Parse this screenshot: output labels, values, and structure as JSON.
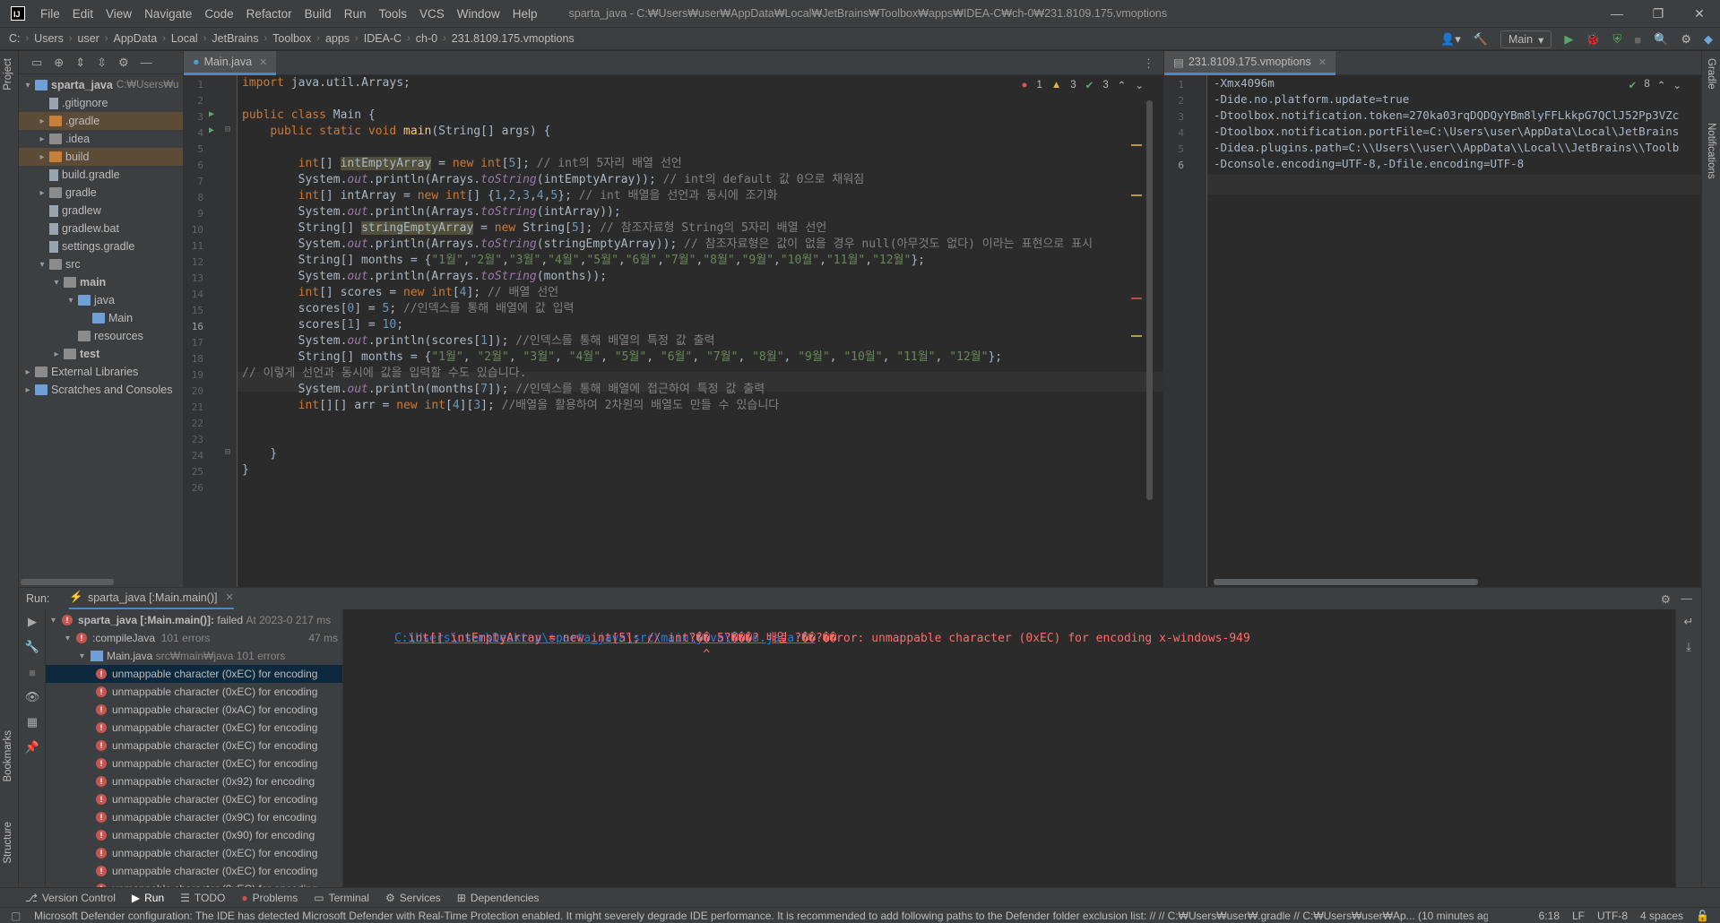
{
  "window": {
    "title": "sparta_java - C:₩Users₩user₩AppData₩Local₩JetBrains₩Toolbox₩apps₩IDEA-C₩ch-0₩231.8109.175.vmoptions",
    "menu": [
      "File",
      "Edit",
      "View",
      "Navigate",
      "Code",
      "Refactor",
      "Build",
      "Run",
      "Tools",
      "VCS",
      "Window",
      "Help"
    ]
  },
  "breadcrumbs": [
    "C:",
    "Users",
    "user",
    "AppData",
    "Local",
    "JetBrains",
    "Toolbox",
    "apps",
    "IDEA-C",
    "ch-0",
    "231.8109.175.vmoptions"
  ],
  "run_config": "Main",
  "left_stripe": {
    "project": "Project",
    "bookmarks": "Bookmarks",
    "structure": "Structure"
  },
  "right_stripe": {
    "gradle": "Gradle",
    "notifications": "Notifications"
  },
  "project_tree": [
    {
      "label": "sparta_java",
      "extra": "C:₩Users₩u",
      "indent": 0,
      "arrow": "▾",
      "icon": "f-blue",
      "bold": true
    },
    {
      "label": ".gitignore",
      "indent": 1,
      "arrow": "",
      "icon": "f-file"
    },
    {
      "label": ".gradle",
      "indent": 1,
      "arrow": "▸",
      "icon": "f-orange",
      "hl": true
    },
    {
      "label": ".idea",
      "indent": 1,
      "arrow": "▸",
      "icon": "f-grey"
    },
    {
      "label": "build",
      "indent": 1,
      "arrow": "▸",
      "icon": "f-orange",
      "hl": true
    },
    {
      "label": "build.gradle",
      "indent": 1,
      "arrow": "",
      "icon": "f-file"
    },
    {
      "label": "gradle",
      "indent": 1,
      "arrow": "▸",
      "icon": "f-grey"
    },
    {
      "label": "gradlew",
      "indent": 1,
      "arrow": "",
      "icon": "f-file"
    },
    {
      "label": "gradlew.bat",
      "indent": 1,
      "arrow": "",
      "icon": "f-file"
    },
    {
      "label": "settings.gradle",
      "indent": 1,
      "arrow": "",
      "icon": "f-file"
    },
    {
      "label": "src",
      "indent": 1,
      "arrow": "▾",
      "icon": "f-grey"
    },
    {
      "label": "main",
      "indent": 2,
      "arrow": "▾",
      "icon": "f-grey",
      "bold": true
    },
    {
      "label": "java",
      "indent": 3,
      "arrow": "▾",
      "icon": "f-blue"
    },
    {
      "label": "Main",
      "indent": 4,
      "arrow": "",
      "icon": "f-blue"
    },
    {
      "label": "resources",
      "indent": 3,
      "arrow": "",
      "icon": "f-grey"
    },
    {
      "label": "test",
      "indent": 2,
      "arrow": "▸",
      "icon": "f-grey",
      "bold": true
    },
    {
      "label": "External Libraries",
      "indent": 0,
      "arrow": "▸",
      "icon": "f-grey"
    },
    {
      "label": "Scratches and Consoles",
      "indent": 0,
      "arrow": "▸",
      "icon": "f-blue"
    }
  ],
  "editor_tab": "Main.java",
  "editor_tab2": "231.8109.175.vmoptions",
  "inspection": {
    "errors": "1",
    "warnings": "3",
    "ok": "3"
  },
  "inspection2": {
    "ok": "8"
  },
  "code_lines": [
    [
      [
        "kw",
        "import "
      ],
      [
        "",
        "java.util.Arrays;"
      ]
    ],
    [],
    [
      [
        "kw",
        "public class "
      ],
      [
        "",
        "Main {"
      ]
    ],
    [
      [
        "",
        "    "
      ],
      [
        "kw",
        "public static void "
      ],
      [
        "fn",
        "main"
      ],
      [
        "",
        "(String[] args) {"
      ]
    ],
    [],
    [
      [
        "",
        "        "
      ],
      [
        "kw",
        "int"
      ],
      [
        "",
        "[] "
      ],
      [
        "hlv",
        "intEmptyArray"
      ],
      [
        "",
        " = "
      ],
      [
        "kw",
        "new int"
      ],
      [
        "",
        "["
      ],
      [
        "num",
        "5"
      ],
      [
        "",
        "]; "
      ],
      [
        "cm",
        "// int의 5자리 배열 선언"
      ]
    ],
    [
      [
        "",
        "        System."
      ],
      [
        "it",
        "out"
      ],
      [
        "",
        ".println(Arrays."
      ],
      [
        "it",
        "toString"
      ],
      [
        "",
        "(intEmptyArray)); "
      ],
      [
        "cm",
        "// int의 default 값 0으로 채워짐"
      ]
    ],
    [
      [
        "",
        "        "
      ],
      [
        "kw",
        "int"
      ],
      [
        "",
        "[] intArray = "
      ],
      [
        "kw",
        "new int"
      ],
      [
        "",
        "[] {"
      ],
      [
        "num",
        "1"
      ],
      [
        "",
        ","
      ],
      [
        "num",
        "2"
      ],
      [
        "",
        ","
      ],
      [
        "num",
        "3"
      ],
      [
        "",
        ","
      ],
      [
        "num",
        "4"
      ],
      [
        "",
        ","
      ],
      [
        "num",
        "5"
      ],
      [
        "",
        "}; "
      ],
      [
        "cm",
        "// int 배열을 선언과 동시에 조기화"
      ]
    ],
    [
      [
        "",
        "        System."
      ],
      [
        "it",
        "out"
      ],
      [
        "",
        ".println(Arrays."
      ],
      [
        "it",
        "toString"
      ],
      [
        "",
        "(intArray));"
      ]
    ],
    [
      [
        "",
        "        String[] "
      ],
      [
        "hlv",
        "stringEmptyArray"
      ],
      [
        "",
        " = "
      ],
      [
        "kw",
        "new "
      ],
      [
        "",
        "String["
      ],
      [
        "num",
        "5"
      ],
      [
        "",
        "]; "
      ],
      [
        "cm",
        "// 참조자료형 String의 5자리 배열 선언"
      ]
    ],
    [
      [
        "",
        "        System."
      ],
      [
        "it",
        "out"
      ],
      [
        "",
        ".println(Arrays."
      ],
      [
        "it",
        "toString"
      ],
      [
        "",
        "(stringEmptyArray)); "
      ],
      [
        "cm",
        "// 참조자료형은 값이 없을 경우 null(아무것도 없다) 이라는 표현으로 표시"
      ]
    ],
    [
      [
        "",
        "        String[] months = {"
      ],
      [
        "str",
        "\"1월\""
      ],
      [
        "",
        ","
      ],
      [
        "str",
        "\"2월\""
      ],
      [
        "",
        ","
      ],
      [
        "str",
        "\"3월\""
      ],
      [
        "",
        ","
      ],
      [
        "str",
        "\"4월\""
      ],
      [
        "",
        ","
      ],
      [
        "str",
        "\"5월\""
      ],
      [
        "",
        ","
      ],
      [
        "str",
        "\"6월\""
      ],
      [
        "",
        ","
      ],
      [
        "str",
        "\"7월\""
      ],
      [
        "",
        ","
      ],
      [
        "str",
        "\"8월\""
      ],
      [
        "",
        ","
      ],
      [
        "str",
        "\"9월\""
      ],
      [
        "",
        ","
      ],
      [
        "str",
        "\"10월\""
      ],
      [
        "",
        ","
      ],
      [
        "str",
        "\"11월\""
      ],
      [
        "",
        ","
      ],
      [
        "str",
        "\"12월\""
      ],
      [
        "",
        "};"
      ]
    ],
    [
      [
        "",
        "        System."
      ],
      [
        "it",
        "out"
      ],
      [
        "",
        ".println(Arrays."
      ],
      [
        "it",
        "toString"
      ],
      [
        "",
        "(months));"
      ]
    ],
    [
      [
        "",
        "        "
      ],
      [
        "kw",
        "int"
      ],
      [
        "",
        "[] scores = "
      ],
      [
        "kw",
        "new int"
      ],
      [
        "",
        "["
      ],
      [
        "num",
        "4"
      ],
      [
        "",
        "]; "
      ],
      [
        "cm",
        "// 배열 선언"
      ]
    ],
    [
      [
        "",
        "        scores["
      ],
      [
        "num",
        "0"
      ],
      [
        "",
        "] = "
      ],
      [
        "num",
        "5"
      ],
      [
        "",
        "; "
      ],
      [
        "cm",
        "//인덱스를 통해 배열에 값 입력"
      ]
    ],
    [
      [
        "",
        "        scores["
      ],
      [
        "num",
        "1"
      ],
      [
        "",
        "] = "
      ],
      [
        "num",
        "10"
      ],
      [
        "",
        ";"
      ]
    ],
    [
      [
        "",
        "        System."
      ],
      [
        "it",
        "out"
      ],
      [
        "",
        ".println(scores["
      ],
      [
        "num",
        "1"
      ],
      [
        "",
        "]); "
      ],
      [
        "cm",
        "//인덱스를 통해 배열의 특정 값 출력"
      ]
    ],
    [
      [
        "",
        "        String[] months = {"
      ],
      [
        "str",
        "\"1월\""
      ],
      [
        "",
        ", "
      ],
      [
        "str",
        "\"2월\""
      ],
      [
        "",
        ", "
      ],
      [
        "str",
        "\"3월\""
      ],
      [
        "",
        ", "
      ],
      [
        "str",
        "\"4월\""
      ],
      [
        "",
        ", "
      ],
      [
        "str",
        "\"5월\""
      ],
      [
        "",
        ", "
      ],
      [
        "str",
        "\"6월\""
      ],
      [
        "",
        ", "
      ],
      [
        "str",
        "\"7월\""
      ],
      [
        "",
        ", "
      ],
      [
        "str",
        "\"8월\""
      ],
      [
        "",
        ", "
      ],
      [
        "str",
        "\"9월\""
      ],
      [
        "",
        ", "
      ],
      [
        "str",
        "\"10월\""
      ],
      [
        "",
        ", "
      ],
      [
        "str",
        "\"11월\""
      ],
      [
        "",
        ", "
      ],
      [
        "str",
        "\"12월\""
      ],
      [
        "",
        "};"
      ]
    ],
    [
      [
        "cm",
        "// 이렇게 선언과 동시에 값을 입력할 수도 있습니다."
      ]
    ],
    [
      [
        "",
        "        System."
      ],
      [
        "it",
        "out"
      ],
      [
        "",
        ".println(months["
      ],
      [
        "num",
        "7"
      ],
      [
        "",
        "]); "
      ],
      [
        "cm",
        "//인덱스를 통해 배열에 접근하여 특정 값 출력"
      ]
    ],
    [
      [
        "",
        "        "
      ],
      [
        "kw",
        "int"
      ],
      [
        "",
        "[][] arr = "
      ],
      [
        "kw",
        "new int"
      ],
      [
        "",
        "["
      ],
      [
        "num",
        "4"
      ],
      [
        "",
        "]["
      ],
      [
        "num",
        "3"
      ],
      [
        "",
        "]; "
      ],
      [
        "cm",
        "//배열을 활용하여 2차원의 배열도 만들 수 있습니다"
      ]
    ],
    [],
    [],
    [
      [
        "",
        "    }"
      ]
    ],
    [
      [
        "",
        "}"
      ]
    ],
    []
  ],
  "vmoptions_lines": [
    "-Xmx4096m",
    "-Dide.no.platform.update=true",
    "-Dtoolbox.notification.token=270ka03rqDQDQyYBm8lyFFLkkpG7QClJ52Pp3VZc",
    "-Dtoolbox.notification.portFile=C:\\Users\\user\\AppData\\Local\\JetBrains",
    "-Didea.plugins.path=C:\\\\Users\\\\user\\\\AppData\\\\Local\\\\JetBrains\\\\Toolb",
    "-Dconsole.encoding=UTF-8,-Dfile.encoding=UTF-8"
  ],
  "run_panel": {
    "label": "Run:",
    "tab": "sparta_java [:Main.main()]",
    "tree_root": "sparta_java [:Main.main()]:",
    "tree_root_status": "failed",
    "tree_root_time": "At 2023-0 217 ms",
    "compile": ":compileJava",
    "compile_count": "101 errors",
    "compile_time": "47 ms",
    "file": "Main.java",
    "file_path": "src₩main₩java",
    "file_count": "101 errors",
    "errors": [
      "unmappable character (0xEC) for encoding",
      "unmappable character (0xEC) for encoding",
      "unmappable character (0xAC) for encoding",
      "unmappable character (0xEC) for encoding",
      "unmappable character (0xEC) for encoding",
      "unmappable character (0xEC) for encoding",
      "unmappable character (0x92) for encoding",
      "unmappable character (0xEC) for encoding",
      "unmappable character (0x9C) for encoding",
      "unmappable character (0x90) for encoding",
      "unmappable character (0xEC) for encoding",
      "unmappable character (0xEC) for encoding",
      "unmappable character (0xEC) for encoding"
    ]
  },
  "console": {
    "link": "C:\\Users\\user\\Desktop\\sparta_java\\src\\main\\java\\Main.java:6:",
    "error": " error: unmappable character (0xEC) for encoding x-windows-949",
    "code": "        int[] intEmptyArray = new int[5]; // int?�� 5?���? 배열 ?��?��",
    "caret": "                                                  ^"
  },
  "bottom_tabs": [
    "Version Control",
    "Run",
    "TODO",
    "Problems",
    "Terminal",
    "Services",
    "Dependencies"
  ],
  "status": {
    "message": "Microsoft Defender configuration: The IDE has detected Microsoft Defender with Real-Time Protection enabled. It might severely degrade IDE performance. It is recommended to add following paths to the Defender folder exclusion list: // // C:₩Users₩user₩.gradle // C:₩Users₩user₩Ap... (10 minutes ago)",
    "position": "6:18",
    "line_sep": "LF",
    "encoding": "UTF-8",
    "indent": "4 spaces"
  },
  "colors": {
    "accent": "#4a88c7",
    "error": "#c75450",
    "keyword": "#cc7832",
    "string": "#6a8759"
  }
}
